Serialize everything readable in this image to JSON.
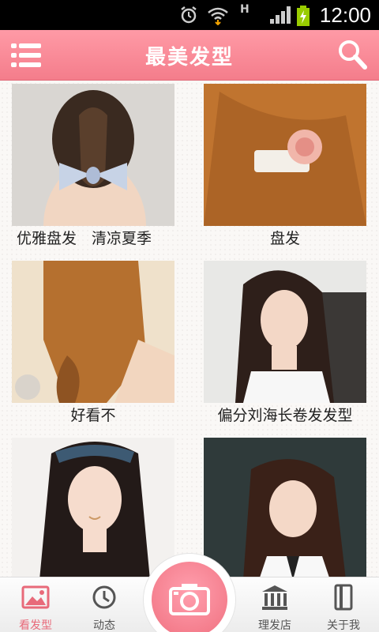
{
  "status_bar": {
    "time": "12:00",
    "network_label": "H"
  },
  "header": {
    "title": "最美发型"
  },
  "grid": {
    "items": [
      {
        "caption": "优雅盘发　清凉夏季"
      },
      {
        "caption": "盘发"
      },
      {
        "caption": "好看不"
      },
      {
        "caption": "偏分刘海长卷发发型"
      },
      {
        "caption": ""
      },
      {
        "caption": ""
      }
    ]
  },
  "bottom_nav": {
    "items": [
      {
        "label": "看发型"
      },
      {
        "label": "动态"
      },
      {
        "label": "理发店"
      },
      {
        "label": "关于我"
      }
    ]
  },
  "colors": {
    "accent": "#f47d8b",
    "active_label": "#e86a7a"
  }
}
